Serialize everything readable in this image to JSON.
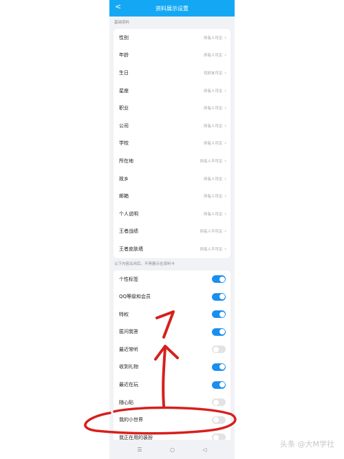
{
  "header": {
    "back": "<",
    "title": "资料展示设置"
  },
  "basic": {
    "section_label": "基础资料",
    "items": [
      {
        "label": "性别",
        "value": "所有人可见"
      },
      {
        "label": "年龄",
        "value": "所有人可见"
      },
      {
        "label": "生日",
        "value": "仅好友可见"
      },
      {
        "label": "星座",
        "value": "所有人可见"
      },
      {
        "label": "职业",
        "value": "所有人可见"
      },
      {
        "label": "公司",
        "value": "所有人可见"
      },
      {
        "label": "学校",
        "value": "所有人可见"
      },
      {
        "label": "所在地",
        "value": "所有人不可见"
      },
      {
        "label": "故乡",
        "value": "所有人可见"
      },
      {
        "label": "邮箱",
        "value": "所有人可见"
      },
      {
        "label": "个人说明",
        "value": "所有人可见"
      },
      {
        "label": "王者战绩",
        "value": "所有人不可见"
      },
      {
        "label": "王者皮肤墙",
        "value": "所有人不可见"
      }
    ]
  },
  "display": {
    "section_label": "以下内容关闭后，不再展示在资料卡",
    "items": [
      {
        "label": "个性标签",
        "on": true
      },
      {
        "label": "QQ等级和会员",
        "on": true
      },
      {
        "label": "特权",
        "on": true
      },
      {
        "label": "匿问我答",
        "on": true
      },
      {
        "label": "最近常听",
        "on": false
      },
      {
        "label": "收到礼物",
        "on": true
      },
      {
        "label": "最近在玩",
        "on": true
      },
      {
        "label": "随心贴",
        "on": false
      },
      {
        "label": "我的小世界",
        "on": false
      },
      {
        "label": "我正在用的装扮",
        "on": false
      }
    ]
  },
  "navbar": {
    "menu": "☰",
    "home": "○",
    "back": "◁"
  },
  "watermark": "头条 @大M学社",
  "colors": {
    "header": "#14a8f4",
    "toggle_on": "#1a8fee",
    "annotation": "#d6201c"
  }
}
